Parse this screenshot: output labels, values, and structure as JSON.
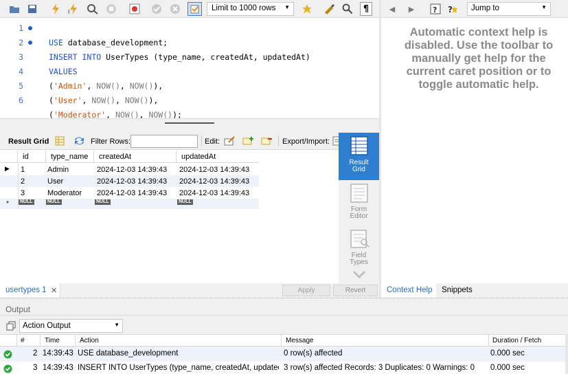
{
  "editor_toolbar": {
    "limit_select": "Limit to 1000 rows"
  },
  "help_toolbar": {
    "jump_to": "Jump to"
  },
  "editor": {
    "lines": [
      {
        "num": "1",
        "dot": true
      },
      {
        "num": "2",
        "dot": true
      },
      {
        "num": "3",
        "dot": false
      },
      {
        "num": "4",
        "dot": false
      },
      {
        "num": "5",
        "dot": false
      },
      {
        "num": "6",
        "dot": false
      }
    ],
    "line1": {
      "kw": "USE",
      "rest": " database_development;"
    },
    "line2": {
      "kw1": "INSERT",
      "kw2": "INTO",
      "rest": " UserTypes (type_name, createdAt, updatedAt)"
    },
    "line3": {
      "kw": "VALUES"
    },
    "line4": {
      "open": "(",
      "str": "'Admin'",
      "comma": ", ",
      "f1": "NOW()",
      "sep": ", ",
      "f2": "NOW()",
      "close": "),"
    },
    "line5": {
      "open": "(",
      "str": "'User'",
      "comma": ", ",
      "f1": "NOW()",
      "sep": ", ",
      "f2": "NOW()",
      "close": "),"
    },
    "line6": {
      "open": "(",
      "str": "'Moderator'",
      "comma": ", ",
      "f1": "NOW()",
      "sep": ", ",
      "f2": "NOW()",
      "close": ");"
    }
  },
  "help_text": "Automatic context help is disabled. Use the toolbar to manually get help for the current caret position or to toggle automatic help.",
  "result_toolbar": {
    "result_grid": "Result Grid",
    "filter_rows": "Filter Rows:",
    "edit": "Edit:",
    "export_import": "Export/Import:"
  },
  "grid": {
    "columns": [
      "id",
      "type_name",
      "createdAt",
      "updatedAt"
    ],
    "rows": [
      {
        "id": "1",
        "type_name": "Admin",
        "createdAt": "2024-12-03 14:39:43",
        "updatedAt": "2024-12-03 14:39:43"
      },
      {
        "id": "2",
        "type_name": "User",
        "createdAt": "2024-12-03 14:39:43",
        "updatedAt": "2024-12-03 14:39:43"
      },
      {
        "id": "3",
        "type_name": "Moderator",
        "createdAt": "2024-12-03 14:39:43",
        "updatedAt": "2024-12-03 14:39:43"
      }
    ],
    "null_label": "NULL"
  },
  "side_panel": {
    "result_grid": [
      "Result",
      "Grid"
    ],
    "form_editor": [
      "Form",
      "Editor"
    ],
    "field_types": [
      "Field",
      "Types"
    ]
  },
  "result_tab": "usertypes 1",
  "buttons": {
    "apply": "Apply",
    "revert": "Revert"
  },
  "help_tabs": {
    "context_help": "Context Help",
    "snippets": "Snippets"
  },
  "output": {
    "title": "Output",
    "select": "Action Output",
    "columns": [
      "#",
      "Time",
      "Action",
      "Message",
      "Duration / Fetch"
    ],
    "rows": [
      {
        "num": "2",
        "time": "14:39:43",
        "action": "USE database_development",
        "message": "0 row(s) affected",
        "duration": "0.000 sec"
      },
      {
        "num": "3",
        "time": "14:39:43",
        "action": "INSERT INTO UserTypes (type_name, createdAt, updated...",
        "message": "3 row(s) affected Records: 3  Duplicates: 0  Warnings: 0",
        "duration": "0.000 sec"
      }
    ]
  }
}
